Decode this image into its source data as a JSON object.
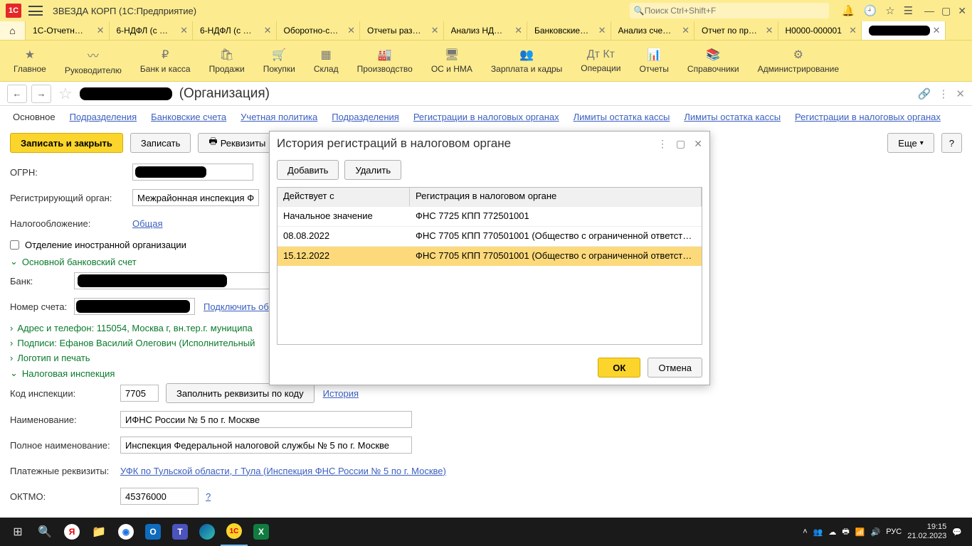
{
  "titlebar": {
    "app_title": "ЗВЕЗДА КОРП  (1С:Предприятие)",
    "search_placeholder": "Поиск Ctrl+Shift+F"
  },
  "tabs": [
    {
      "label": "1С-Отчетн…"
    },
    {
      "label": "6-НДФЛ (с …"
    },
    {
      "label": "6-НДФЛ (с …"
    },
    {
      "label": "Оборотно-с…"
    },
    {
      "label": "Отчеты раз…"
    },
    {
      "label": "Анализ НД…"
    },
    {
      "label": "Банковские…"
    },
    {
      "label": "Анализ сче…"
    },
    {
      "label": "Отчет по пр…"
    },
    {
      "label": "Н0000-000001"
    }
  ],
  "nav": [
    {
      "icon": "★",
      "label": "Главное"
    },
    {
      "icon": "〰",
      "label": "Руководителю"
    },
    {
      "icon": "₽",
      "label": "Банк и касса"
    },
    {
      "icon": "🛍",
      "label": "Продажи"
    },
    {
      "icon": "🛒",
      "label": "Покупки"
    },
    {
      "icon": "▦",
      "label": "Склад"
    },
    {
      "icon": "🏭",
      "label": "Производство"
    },
    {
      "icon": "🖥",
      "label": "ОС и НМА"
    },
    {
      "icon": "👥",
      "label": "Зарплата и кадры"
    },
    {
      "icon": "Дт\nКт",
      "label": "Операции"
    },
    {
      "icon": "📊",
      "label": "Отчеты"
    },
    {
      "icon": "📚",
      "label": "Справочники"
    },
    {
      "icon": "⚙",
      "label": "Администрирование"
    }
  ],
  "header": {
    "org_suffix": "(Организация)"
  },
  "subtabs": [
    "Основное",
    "Подразделения",
    "Банковские счета",
    "Учетная политика",
    "Подразделения",
    "Регистрации в налоговых органах",
    "Лимиты остатка кассы",
    "Лимиты остатка кассы",
    "Регистрации в налоговых органах"
  ],
  "buttons": {
    "save_close": "Записать и закрыть",
    "save": "Записать",
    "requisites": "Реквизиты",
    "more": "Еще",
    "help": "?"
  },
  "form": {
    "ogrn_label": "ОГРН:",
    "reg_organ_label": "Регистрирующий орган:",
    "reg_organ_value": "Межрайонная инспекция Фе",
    "tax_label": "Налогообложение:",
    "tax_value": "Общая",
    "foreign_checkbox": "Отделение иностранной организации",
    "bank_section": "Основной банковский счет",
    "bank_label": "Банк:",
    "account_label": "Номер счета:",
    "connect_link": "Подключить об",
    "address_section": "Адрес и телефон: 115054, Москва г, вн.тер.г. муниципа",
    "sign_section": "Подписи: Ефанов Василий Олегович (Исполнительный",
    "logo_section": "Логотип и печать",
    "tax_inspection_section": "Налоговая инспекция",
    "code_label": "Код инспекции:",
    "code_value": "7705",
    "fill_btn": "Заполнить реквизиты по коду",
    "history_link": "История",
    "name_label": "Наименование:",
    "name_value": "ИФНС России № 5 по г. Москве",
    "fullname_label": "Полное наименование:",
    "fullname_value": "Инспекция Федеральной налоговой службы № 5 по г. Москве",
    "payment_label": "Платежные реквизиты:",
    "payment_value": "УФК по Тульской области, г Тула (Инспекция ФНС России № 5 по г. Москве)",
    "oktmo_label": "ОКТМО:",
    "oktmo_value": "45376000",
    "oktmo_help": "?"
  },
  "dialog": {
    "title": "История регистраций в налоговом органе",
    "add": "Добавить",
    "delete": "Удалить",
    "col1": "Действует с",
    "col2": "Регистрация в налоговом органе",
    "rows": [
      {
        "c1": "Начальное значение",
        "c2": "ФНС 7725 КПП 772501001"
      },
      {
        "c1": "08.08.2022",
        "c2": "ФНС 7705 КПП 770501001 (Общество с ограниченной ответств…"
      },
      {
        "c1": "15.12.2022",
        "c2": "ФНС 7705 КПП 770501001 (Общество с ограниченной ответств…"
      }
    ],
    "ok": "ОК",
    "cancel": "Отмена"
  },
  "taskbar": {
    "lang": "РУС",
    "time": "19:15",
    "date": "21.02.2023"
  }
}
